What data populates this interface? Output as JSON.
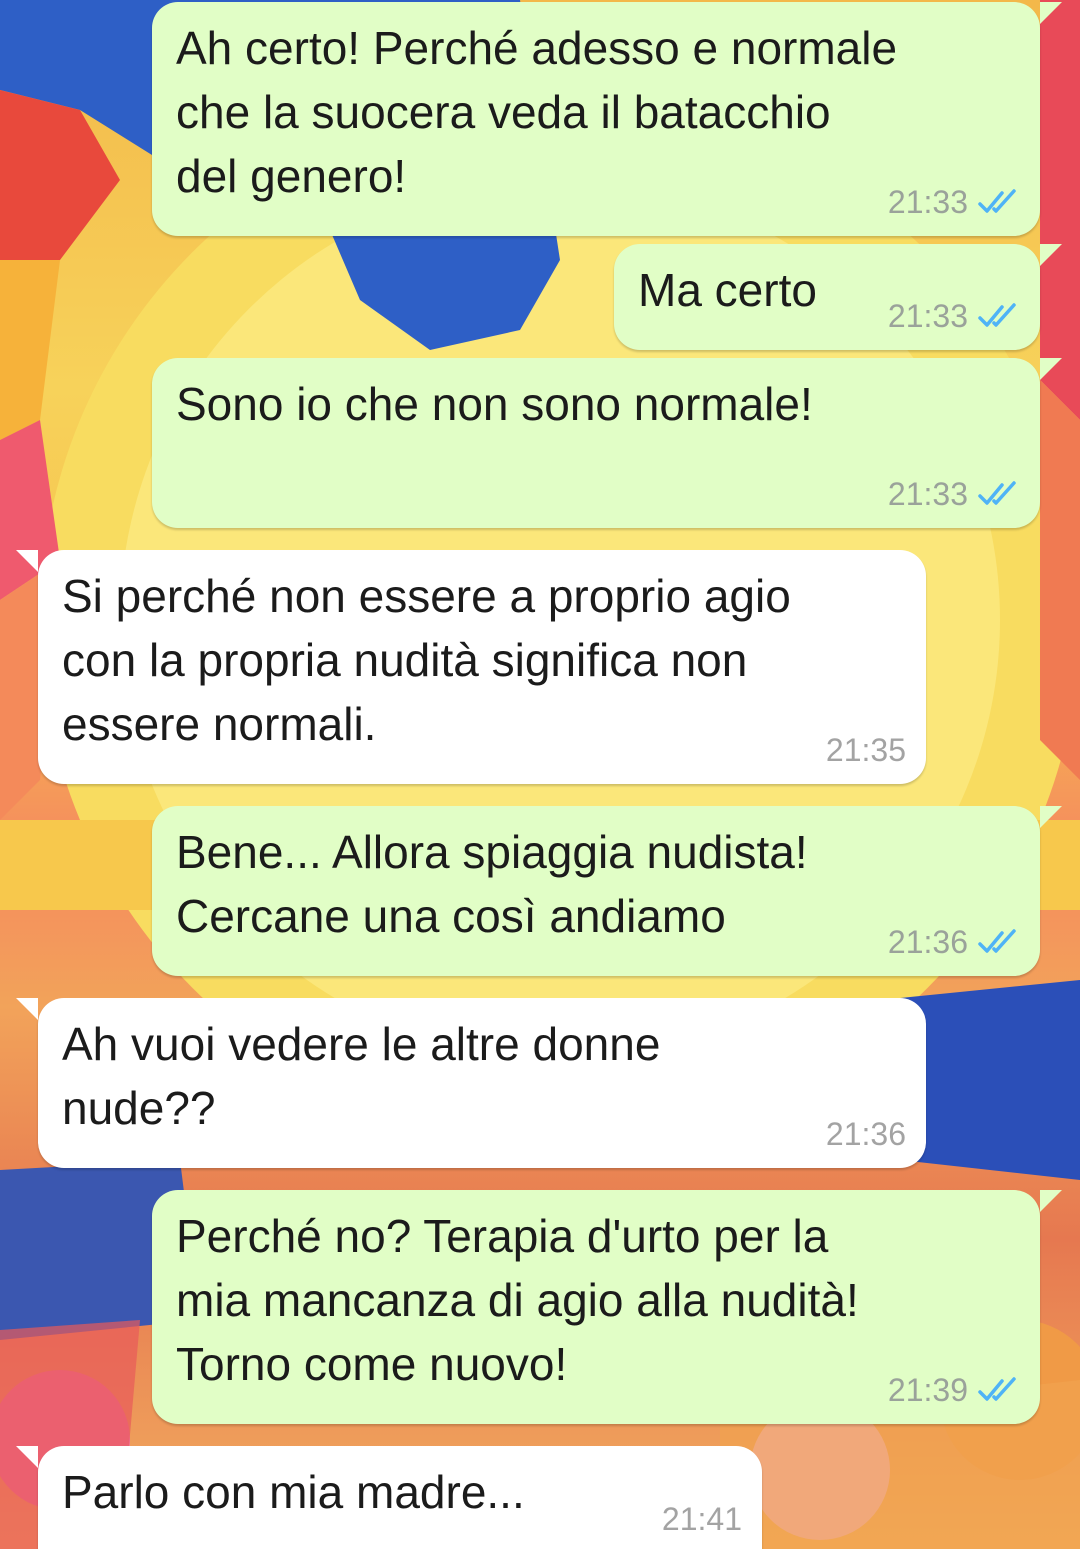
{
  "theme": {
    "outgoing_bubble": "#e1fec6",
    "incoming_bubble": "#ffffff",
    "read_tick_color": "#4fb3f6",
    "wallpaper": "colorful-cartoon-beach-illustration"
  },
  "messages": [
    {
      "direction": "out",
      "text": "Ah certo! Perché adesso e normale\nche la suocera veda il batacchio\ndel genero!",
      "time": "21:33",
      "status_icon": "double-check-read-icon"
    },
    {
      "direction": "out",
      "text": "Ma certo",
      "time": "21:33",
      "status_icon": "double-check-read-icon"
    },
    {
      "direction": "out",
      "text": "Sono io che non sono normale!",
      "time": "21:33",
      "status_icon": "double-check-read-icon"
    },
    {
      "direction": "in",
      "text": "Si perché non essere a proprio agio\ncon la propria nudità significa non\nessere normali.",
      "time": "21:35"
    },
    {
      "direction": "out",
      "text": "Bene... Allora spiaggia nudista!\nCercane una così andiamo",
      "time": "21:36",
      "status_icon": "double-check-read-icon"
    },
    {
      "direction": "in",
      "text": "Ah vuoi vedere le altre donne\nnude??",
      "time": "21:36"
    },
    {
      "direction": "out",
      "text": "Perché no? Terapia d'urto per la\nmia mancanza di agio alla nudità!\nTorno come nuovo!",
      "time": "21:39",
      "status_icon": "double-check-read-icon"
    },
    {
      "direction": "in",
      "text": "Parlo con mia madre...",
      "time": "21:41"
    }
  ]
}
